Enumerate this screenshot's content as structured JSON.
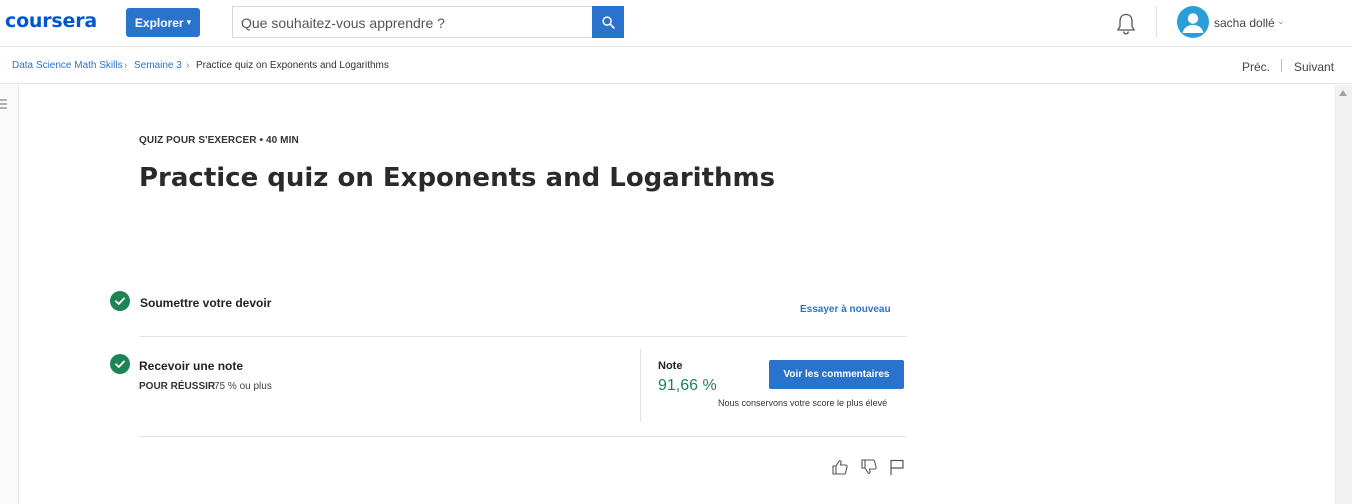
{
  "header": {
    "logo": "coursera",
    "explore_label": "Explorer",
    "search_placeholder": "Que souhaitez-vous apprendre ?",
    "user_name": "sacha dollé",
    "icons": [
      "search-icon",
      "bell-icon",
      "avatar-icon",
      "chevron-down-icon"
    ]
  },
  "breadcrumb": {
    "items": [
      "Data Science Math Skills",
      "Semaine 3",
      "Practice quiz on Exponents and Logarithms"
    ],
    "prev_label": "Préc.",
    "next_label": "Suivant"
  },
  "quiz": {
    "kicker": "QUIZ POUR S'EXERCER • 40  MIN",
    "title": "Practice quiz on Exponents and Logarithms"
  },
  "steps": {
    "submit": {
      "title": "Soumettre votre devoir",
      "action": "Essayer à nouveau"
    },
    "grade": {
      "title": "Recevoir une note",
      "pass_label": "POUR RÉUSSIR",
      "pass_value": "75 % ou plus",
      "grade_label": "Note",
      "grade_value": "91,66 %",
      "feedback_button": "Voir les commentaires",
      "keep_note": "Nous conservons votre score le plus élevé"
    }
  },
  "feedback_icons": [
    "thumbs-up-icon",
    "thumbs-down-icon",
    "flag-icon"
  ],
  "colors": {
    "brand_blue": "#0056d2",
    "button_blue": "#2a73cc",
    "success_green": "#1f8354"
  }
}
